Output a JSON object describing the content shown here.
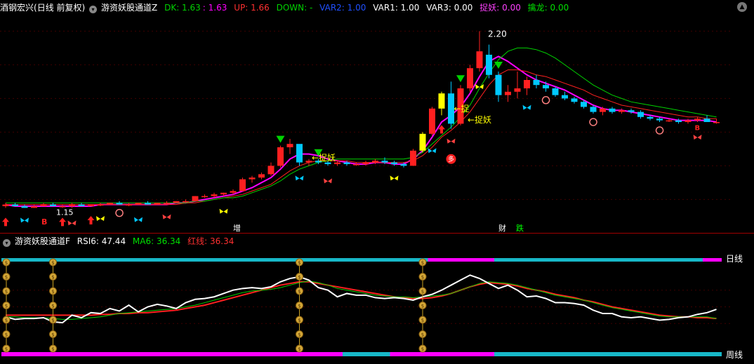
{
  "colors": {
    "bg": "#000000",
    "up": "#ff2020",
    "down": "#00c8ff",
    "magenta": "#ff00ff",
    "cyan": "#17b8c8",
    "green": "#00d200",
    "yellow": "#ffff00",
    "white": "#ffffff",
    "divider": "#a00000"
  },
  "main_panel": {
    "stock_name": "酒钢宏兴",
    "period_label": "(日线 前复权)",
    "indicator_name": "游资妖股通道Z",
    "dk_label": "DK: 1.63",
    "dk_value2": ": 1.63",
    "up_label": "UP: 1.66",
    "down_label": "DOWN: -",
    "var2_label": "VAR2: 1.00",
    "var1_label": "VAR1: 1.00",
    "var3_label": "VAR3: 0.00",
    "zhuoyao_label": "捉妖: 0.00",
    "qinlong_label": "擒龙: 0.00",
    "high_label": "2.20",
    "low_label": "1.15",
    "zhuoyao_marker_1": "←捉妖",
    "zhuoyao_marker_2": "←捉",
    "zhuoyao_marker_3": "←捉妖",
    "duo_badge": "多",
    "zeng_badge": "增",
    "cai_badge": "财",
    "die_badge": "跌",
    "b_badge": "B"
  },
  "sub_panel": {
    "indicator_name": "游资妖股通道F",
    "rsi_label": "RSI6: 47.44",
    "ma_label": "MA6: 36.34",
    "red_label": "红线: 36.34",
    "daily_band": "日线",
    "weekly_band": "周线",
    "coin_glyph": "$"
  },
  "chart_data": [
    {
      "type": "candlestick",
      "title": "",
      "price_range": [
        1.06,
        2.26
      ],
      "annotations": {
        "high": 2.2,
        "low": 1.15
      },
      "candles": [
        {
          "o": 1.16,
          "h": 1.18,
          "l": 1.15,
          "c": 1.17
        },
        {
          "o": 1.17,
          "h": 1.18,
          "l": 1.16,
          "c": 1.16
        },
        {
          "o": 1.16,
          "h": 1.17,
          "l": 1.15,
          "c": 1.15
        },
        {
          "o": 1.15,
          "h": 1.17,
          "l": 1.15,
          "c": 1.16
        },
        {
          "o": 1.16,
          "h": 1.18,
          "l": 1.16,
          "c": 1.17
        },
        {
          "o": 1.17,
          "h": 1.18,
          "l": 1.16,
          "c": 1.16
        },
        {
          "o": 1.16,
          "h": 1.17,
          "l": 1.15,
          "c": 1.16
        },
        {
          "o": 1.16,
          "h": 1.18,
          "l": 1.15,
          "c": 1.17
        },
        {
          "o": 1.17,
          "h": 1.18,
          "l": 1.16,
          "c": 1.16
        },
        {
          "o": 1.16,
          "h": 1.17,
          "l": 1.16,
          "c": 1.17
        },
        {
          "o": 1.17,
          "h": 1.18,
          "l": 1.16,
          "c": 1.17
        },
        {
          "o": 1.17,
          "h": 1.18,
          "l": 1.17,
          "c": 1.18
        },
        {
          "o": 1.18,
          "h": 1.19,
          "l": 1.17,
          "c": 1.17
        },
        {
          "o": 1.17,
          "h": 1.18,
          "l": 1.16,
          "c": 1.17
        },
        {
          "o": 1.17,
          "h": 1.18,
          "l": 1.17,
          "c": 1.18
        },
        {
          "o": 1.18,
          "h": 1.19,
          "l": 1.17,
          "c": 1.17
        },
        {
          "o": 1.17,
          "h": 1.18,
          "l": 1.17,
          "c": 1.18
        },
        {
          "o": 1.18,
          "h": 1.19,
          "l": 1.17,
          "c": 1.18
        },
        {
          "o": 1.18,
          "h": 1.19,
          "l": 1.18,
          "c": 1.19
        },
        {
          "o": 1.19,
          "h": 1.2,
          "l": 1.18,
          "c": 1.19
        },
        {
          "o": 1.19,
          "h": 1.22,
          "l": 1.19,
          "c": 1.22
        },
        {
          "o": 1.22,
          "h": 1.23,
          "l": 1.21,
          "c": 1.22
        },
        {
          "o": 1.22,
          "h": 1.24,
          "l": 1.21,
          "c": 1.23
        },
        {
          "o": 1.23,
          "h": 1.24,
          "l": 1.22,
          "c": 1.24
        },
        {
          "o": 1.24,
          "h": 1.26,
          "l": 1.23,
          "c": 1.25
        },
        {
          "o": 1.25,
          "h": 1.33,
          "l": 1.25,
          "c": 1.32
        },
        {
          "o": 1.32,
          "h": 1.34,
          "l": 1.3,
          "c": 1.33
        },
        {
          "o": 1.33,
          "h": 1.36,
          "l": 1.32,
          "c": 1.35
        },
        {
          "o": 1.35,
          "h": 1.42,
          "l": 1.34,
          "c": 1.4
        },
        {
          "o": 1.4,
          "h": 1.52,
          "l": 1.39,
          "c": 1.51
        },
        {
          "o": 1.51,
          "h": 1.56,
          "l": 1.47,
          "c": 1.53
        },
        {
          "o": 1.53,
          "h": 1.52,
          "l": 1.4,
          "c": 1.42
        },
        {
          "o": 1.42,
          "h": 1.44,
          "l": 1.4,
          "c": 1.43
        },
        {
          "o": 1.43,
          "h": 1.44,
          "l": 1.41,
          "c": 1.42
        },
        {
          "o": 1.42,
          "h": 1.43,
          "l": 1.4,
          "c": 1.41
        },
        {
          "o": 1.41,
          "h": 1.43,
          "l": 1.4,
          "c": 1.42
        },
        {
          "o": 1.42,
          "h": 1.43,
          "l": 1.4,
          "c": 1.41
        },
        {
          "o": 1.41,
          "h": 1.42,
          "l": 1.4,
          "c": 1.41
        },
        {
          "o": 1.41,
          "h": 1.43,
          "l": 1.4,
          "c": 1.42
        },
        {
          "o": 1.42,
          "h": 1.44,
          "l": 1.41,
          "c": 1.43
        },
        {
          "o": 1.43,
          "h": 1.45,
          "l": 1.41,
          "c": 1.42
        },
        {
          "o": 1.42,
          "h": 1.43,
          "l": 1.4,
          "c": 1.41
        },
        {
          "o": 1.41,
          "h": 1.42,
          "l": 1.39,
          "c": 1.4
        },
        {
          "o": 1.4,
          "h": 1.5,
          "l": 1.4,
          "c": 1.49
        },
        {
          "o": 1.49,
          "h": 1.6,
          "l": 1.48,
          "c": 1.59
        },
        {
          "o": 1.59,
          "h": 1.75,
          "l": 1.58,
          "c": 1.74
        },
        {
          "o": 1.74,
          "h": 1.84,
          "l": 1.7,
          "c": 1.83
        },
        {
          "o": 1.83,
          "h": 1.9,
          "l": 1.62,
          "c": 1.65
        },
        {
          "o": 1.65,
          "h": 1.88,
          "l": 1.64,
          "c": 1.86
        },
        {
          "o": 1.86,
          "h": 2.0,
          "l": 1.84,
          "c": 1.98
        },
        {
          "o": 1.98,
          "h": 2.2,
          "l": 1.96,
          "c": 2.08
        },
        {
          "o": 2.06,
          "h": 2.12,
          "l": 1.92,
          "c": 1.94
        },
        {
          "o": 1.94,
          "h": 1.96,
          "l": 1.78,
          "c": 1.82
        },
        {
          "o": 1.82,
          "h": 1.88,
          "l": 1.78,
          "c": 1.84
        },
        {
          "o": 1.84,
          "h": 1.96,
          "l": 1.8,
          "c": 1.86
        },
        {
          "o": 1.86,
          "h": 1.93,
          "l": 1.82,
          "c": 1.91
        },
        {
          "o": 1.91,
          "h": 1.94,
          "l": 1.86,
          "c": 1.88
        },
        {
          "o": 1.88,
          "h": 1.9,
          "l": 1.84,
          "c": 1.86
        },
        {
          "o": 1.86,
          "h": 1.87,
          "l": 1.81,
          "c": 1.82
        },
        {
          "o": 1.82,
          "h": 1.84,
          "l": 1.79,
          "c": 1.8
        },
        {
          "o": 1.8,
          "h": 1.81,
          "l": 1.77,
          "c": 1.78
        },
        {
          "o": 1.78,
          "h": 1.79,
          "l": 1.74,
          "c": 1.75
        },
        {
          "o": 1.75,
          "h": 1.76,
          "l": 1.71,
          "c": 1.72
        },
        {
          "o": 1.72,
          "h": 1.75,
          "l": 1.7,
          "c": 1.74
        },
        {
          "o": 1.74,
          "h": 1.75,
          "l": 1.71,
          "c": 1.72
        },
        {
          "o": 1.72,
          "h": 1.74,
          "l": 1.71,
          "c": 1.73
        },
        {
          "o": 1.73,
          "h": 1.74,
          "l": 1.71,
          "c": 1.72
        },
        {
          "o": 1.72,
          "h": 1.73,
          "l": 1.68,
          "c": 1.69
        },
        {
          "o": 1.69,
          "h": 1.7,
          "l": 1.67,
          "c": 1.68
        },
        {
          "o": 1.68,
          "h": 1.69,
          "l": 1.66,
          "c": 1.67
        },
        {
          "o": 1.67,
          "h": 1.68,
          "l": 1.66,
          "c": 1.67
        },
        {
          "o": 1.67,
          "h": 1.68,
          "l": 1.65,
          "c": 1.66
        },
        {
          "o": 1.66,
          "h": 1.68,
          "l": 1.65,
          "c": 1.67
        },
        {
          "o": 1.67,
          "h": 1.69,
          "l": 1.66,
          "c": 1.68
        },
        {
          "o": 1.68,
          "h": 1.7,
          "l": 1.66,
          "c": 1.66
        },
        {
          "o": 1.66,
          "h": 1.68,
          "l": 1.65,
          "c": 1.66
        }
      ],
      "series": [
        {
          "values": [
            1.17,
            1.16,
            1.16,
            1.16,
            1.16,
            1.16,
            1.16,
            1.16,
            1.16,
            1.16,
            1.17,
            1.17,
            1.17,
            1.17,
            1.17,
            1.17,
            1.17,
            1.17,
            1.18,
            1.18,
            1.19,
            1.2,
            1.21,
            1.22,
            1.23,
            1.25,
            1.27,
            1.3,
            1.33,
            1.38,
            1.44,
            1.47,
            1.47,
            1.46,
            1.44,
            1.43,
            1.42,
            1.41,
            1.41,
            1.42,
            1.42,
            1.41,
            1.41,
            1.44,
            1.49,
            1.57,
            1.66,
            1.7,
            1.75,
            1.83,
            1.93,
            2.02,
            2.05,
            2.02,
            1.98,
            1.94,
            1.91,
            1.89,
            1.87,
            1.85,
            1.82,
            1.79,
            1.76,
            1.74,
            1.73,
            1.73,
            1.72,
            1.71,
            1.7,
            1.69,
            1.68,
            1.67,
            1.67,
            1.67,
            1.67,
            1.66
          ]
        },
        {
          "values": [
            1.17,
            1.17,
            1.17,
            1.17,
            1.17,
            1.17,
            1.17,
            1.17,
            1.17,
            1.17,
            1.17,
            1.17,
            1.17,
            1.17,
            1.17,
            1.17,
            1.17,
            1.17,
            1.17,
            1.18,
            1.18,
            1.19,
            1.2,
            1.21,
            1.22,
            1.23,
            1.25,
            1.27,
            1.29,
            1.33,
            1.37,
            1.4,
            1.42,
            1.43,
            1.43,
            1.43,
            1.43,
            1.42,
            1.42,
            1.42,
            1.42,
            1.42,
            1.42,
            1.43,
            1.46,
            1.51,
            1.57,
            1.61,
            1.66,
            1.72,
            1.8,
            1.88,
            1.94,
            1.97,
            1.97,
            1.96,
            1.94,
            1.93,
            1.91,
            1.89,
            1.87,
            1.85,
            1.82,
            1.8,
            1.78,
            1.76,
            1.75,
            1.74,
            1.73,
            1.72,
            1.71,
            1.7,
            1.69,
            1.69,
            1.68,
            1.68
          ]
        },
        {
          "values": [
            1.18,
            1.18,
            1.18,
            1.18,
            1.18,
            1.18,
            1.18,
            1.18,
            1.18,
            1.18,
            1.18,
            1.18,
            1.18,
            1.18,
            1.18,
            1.18,
            1.18,
            1.18,
            1.18,
            1.18,
            1.19,
            1.19,
            1.2,
            1.21,
            1.21,
            1.22,
            1.24,
            1.26,
            1.28,
            1.31,
            1.35,
            1.38,
            1.4,
            1.42,
            1.43,
            1.44,
            1.44,
            1.44,
            1.44,
            1.44,
            1.44,
            1.44,
            1.44,
            1.45,
            1.48,
            1.53,
            1.58,
            1.63,
            1.69,
            1.76,
            1.86,
            1.95,
            2.03,
            2.08,
            2.1,
            2.1,
            2.09,
            2.07,
            2.04,
            2.0,
            1.96,
            1.92,
            1.88,
            1.85,
            1.82,
            1.8,
            1.78,
            1.77,
            1.76,
            1.75,
            1.74,
            1.73,
            1.72,
            1.71,
            1.7,
            1.69
          ]
        }
      ],
      "markers": {
        "buy_arrows": [
          0,
          6,
          9,
          46
        ],
        "sell_triangles": [
          29,
          33,
          48,
          52
        ],
        "butterflies": [
          2,
          7,
          10,
          14,
          17,
          23,
          31,
          34,
          41,
          45,
          47,
          50,
          55,
          73
        ],
        "drops": [
          12,
          57,
          62,
          69
        ],
        "duo_index": 47
      }
    },
    {
      "type": "line",
      "title": "",
      "ylim": [
        0,
        100
      ],
      "series": [
        {
          "name": "RSI6",
          "values": [
            38,
            35,
            36,
            36,
            37,
            32,
            31,
            40,
            37,
            43,
            42,
            48,
            45,
            52,
            44,
            50,
            53,
            51,
            48,
            55,
            59,
            60,
            62,
            66,
            70,
            72,
            73,
            72,
            74,
            80,
            84,
            86,
            82,
            73,
            70,
            62,
            66,
            64,
            64,
            61,
            60,
            61,
            60,
            58,
            62,
            65,
            70,
            76,
            82,
            88,
            84,
            78,
            72,
            76,
            70,
            62,
            63,
            60,
            55,
            55,
            54,
            52,
            46,
            42,
            42,
            38,
            37,
            38,
            36,
            34,
            35,
            37,
            38,
            41,
            43,
            47
          ]
        },
        {
          "name": "MA6",
          "values": [
            38,
            38,
            37,
            37,
            37,
            36,
            35,
            35,
            36,
            37,
            38,
            40,
            42,
            43,
            44,
            45,
            46,
            47,
            48,
            50,
            52,
            55,
            58,
            61,
            64,
            67,
            69,
            70,
            71,
            73,
            76,
            79,
            81,
            79,
            76,
            72,
            70,
            68,
            66,
            64,
            63,
            62,
            62,
            61,
            62,
            63,
            64,
            66,
            70,
            74,
            78,
            80,
            79,
            78,
            76,
            73,
            70,
            67,
            64,
            62,
            60,
            58,
            55,
            52,
            49,
            47,
            45,
            43,
            41,
            39,
            38,
            38,
            38,
            38,
            38,
            36
          ]
        },
        {
          "name": "红线",
          "values": [
            40,
            40,
            40,
            40,
            40,
            40,
            40,
            40,
            40,
            40,
            41,
            41,
            42,
            42,
            43,
            43,
            44,
            45,
            46,
            48,
            50,
            52,
            55,
            58,
            61,
            64,
            67,
            70,
            73,
            76,
            78,
            80,
            80,
            78,
            76,
            74,
            72,
            70,
            68,
            66,
            64,
            62,
            61,
            60,
            60,
            61,
            63,
            66,
            70,
            74,
            77,
            79,
            78,
            77,
            75,
            72,
            70,
            68,
            65,
            63,
            61,
            58,
            56,
            53,
            50,
            48,
            46,
            44,
            42,
            40,
            39,
            38,
            38,
            37,
            37,
            36
          ]
        }
      ],
      "daily_band": [
        {
          "from": 0,
          "to": 45,
          "color": "cyan"
        },
        {
          "from": 45,
          "to": 52,
          "color": "magenta"
        },
        {
          "from": 52,
          "to": 74,
          "color": "cyan"
        },
        {
          "from": 74,
          "to": 76,
          "color": "magenta"
        }
      ],
      "weekly_band": [
        {
          "from": 0,
          "to": 36,
          "color": "magenta"
        },
        {
          "from": 36,
          "to": 41,
          "color": "cyan"
        },
        {
          "from": 41,
          "to": 52,
          "color": "magenta"
        },
        {
          "from": 52,
          "to": 76,
          "color": "cyan"
        }
      ],
      "coin_columns": [
        0,
        5,
        31,
        44
      ]
    }
  ]
}
